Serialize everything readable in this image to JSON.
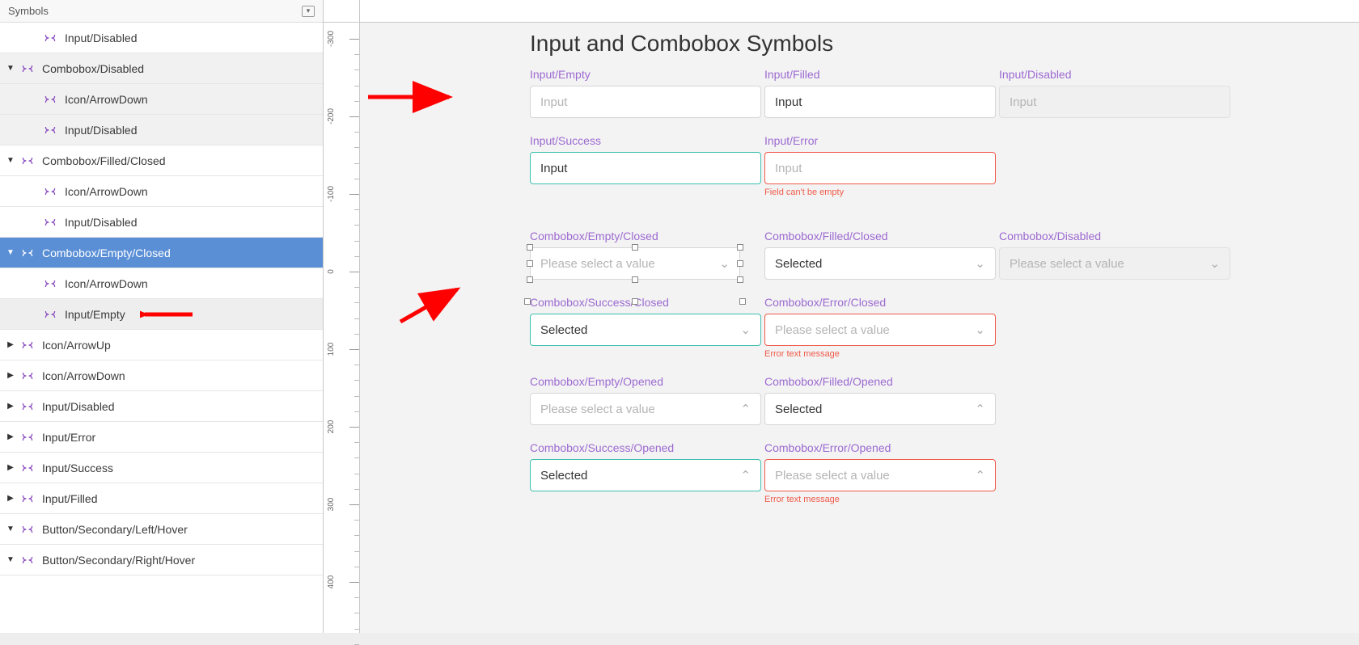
{
  "sidebar": {
    "title": "Symbols",
    "rows": [
      {
        "indent": 1,
        "disc": "none",
        "label": "Input/Disabled",
        "alt": false
      },
      {
        "indent": 0,
        "disc": "open",
        "label": "Combobox/Disabled",
        "alt": true
      },
      {
        "indent": 1,
        "disc": "none",
        "label": "Icon/ArrowDown",
        "alt": true
      },
      {
        "indent": 1,
        "disc": "none",
        "label": "Input/Disabled",
        "alt": true
      },
      {
        "indent": 0,
        "disc": "open",
        "label": "Combobox/Filled/Closed",
        "alt": false
      },
      {
        "indent": 1,
        "disc": "none",
        "label": "Icon/ArrowDown",
        "alt": false
      },
      {
        "indent": 1,
        "disc": "none",
        "label": "Input/Disabled",
        "alt": false
      },
      {
        "indent": 0,
        "disc": "open",
        "label": "Combobox/Empty/Closed",
        "alt": false,
        "selected": true
      },
      {
        "indent": 1,
        "disc": "none",
        "label": "Icon/ArrowDown",
        "alt": false
      },
      {
        "indent": 1,
        "disc": "none",
        "label": "Input/Empty",
        "alt": false,
        "hover": true,
        "arrow": true
      },
      {
        "indent": 0,
        "disc": "closed",
        "label": "Icon/ArrowUp",
        "alt": false
      },
      {
        "indent": 0,
        "disc": "closed",
        "label": "Icon/ArrowDown",
        "alt": false
      },
      {
        "indent": 0,
        "disc": "closed",
        "label": "Input/Disabled",
        "alt": false
      },
      {
        "indent": 0,
        "disc": "closed",
        "label": "Input/Error",
        "alt": false
      },
      {
        "indent": 0,
        "disc": "closed",
        "label": "Input/Success",
        "alt": false
      },
      {
        "indent": 0,
        "disc": "closed",
        "label": "Input/Filled",
        "alt": false
      },
      {
        "indent": 0,
        "disc": "open",
        "label": "Button/Secondary/Left/Hover",
        "alt": false
      },
      {
        "indent": 0,
        "disc": "open",
        "label": "Button/Secondary/Right/Hover",
        "alt": false
      }
    ]
  },
  "ruler": {
    "ticks": [
      "-300",
      "-200",
      "-100",
      "0",
      "100",
      "200",
      "300",
      "400"
    ]
  },
  "canvas": {
    "title": "Input and Combobox Symbols",
    "inputs": {
      "empty": {
        "label": "Input/Empty",
        "placeholder": "Input"
      },
      "filled": {
        "label": "Input/Filled",
        "value": "Input"
      },
      "disabled": {
        "label": "Input/Disabled",
        "placeholder": "Input"
      },
      "success": {
        "label": "Input/Success",
        "value": "Input"
      },
      "error": {
        "label": "Input/Error",
        "placeholder": "Input",
        "help": "Field can't be empty"
      }
    },
    "combos": {
      "empty_closed": {
        "label": "Combobox/Empty/Closed",
        "placeholder": "Please select a value",
        "dir": "down"
      },
      "filled_closed": {
        "label": "Combobox/Filled/Closed",
        "value": "Selected",
        "dir": "down"
      },
      "disabled": {
        "label": "Combobox/Disabled",
        "placeholder": "Please select a value",
        "dir": "down"
      },
      "success_closed": {
        "label": "Combobox/Success/Closed",
        "value": "Selected",
        "dir": "down"
      },
      "error_closed": {
        "label": "Combobox/Error/Closed",
        "placeholder": "Please select a value",
        "dir": "down",
        "help": "Error text message"
      },
      "empty_opened": {
        "label": "Combobox/Empty/Opened",
        "placeholder": "Please select a value",
        "dir": "up"
      },
      "filled_opened": {
        "label": "Combobox/Filled/Opened",
        "value": "Selected",
        "dir": "up"
      },
      "success_opened": {
        "label": "Combobox/Success/Opened",
        "value": "Selected",
        "dir": "up"
      },
      "error_opened": {
        "label": "Combobox/Error/Opened",
        "placeholder": "Please select a value",
        "dir": "up",
        "help": "Error text message"
      }
    }
  }
}
